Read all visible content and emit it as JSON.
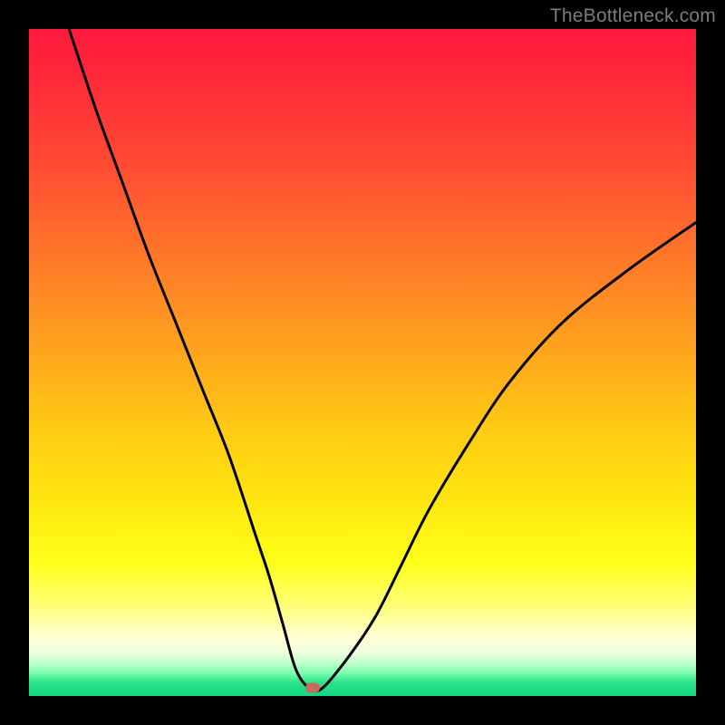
{
  "watermark": "TheBottleneck.com",
  "marker": {
    "x_pct": 42.5,
    "y_pct": 98.8
  },
  "chart_data": {
    "type": "line",
    "title": "",
    "xlabel": "",
    "ylabel": "",
    "xlim": [
      0,
      100
    ],
    "ylim": [
      0,
      100
    ],
    "series": [
      {
        "name": "bottleneck-curve",
        "x": [
          6,
          10,
          14,
          18,
          22,
          26,
          30,
          34,
          36,
          38,
          40,
          42,
          44,
          48,
          52,
          56,
          60,
          66,
          72,
          80,
          90,
          100
        ],
        "y": [
          100,
          88,
          77,
          66,
          56,
          46,
          36,
          24,
          18,
          11,
          4,
          1.2,
          1.2,
          6,
          12,
          20,
          28,
          38,
          47,
          56,
          64,
          71
        ]
      }
    ],
    "gradient_stops": [
      {
        "pos": 0,
        "color": "#ff1a3d"
      },
      {
        "pos": 50,
        "color": "#ffaa1c"
      },
      {
        "pos": 80,
        "color": "#ffff1a"
      },
      {
        "pos": 95,
        "color": "#c0ffcc"
      },
      {
        "pos": 100,
        "color": "#10d880"
      }
    ],
    "marker": {
      "x": 42.5,
      "y": 1.2,
      "color": "#c96a5c"
    }
  }
}
